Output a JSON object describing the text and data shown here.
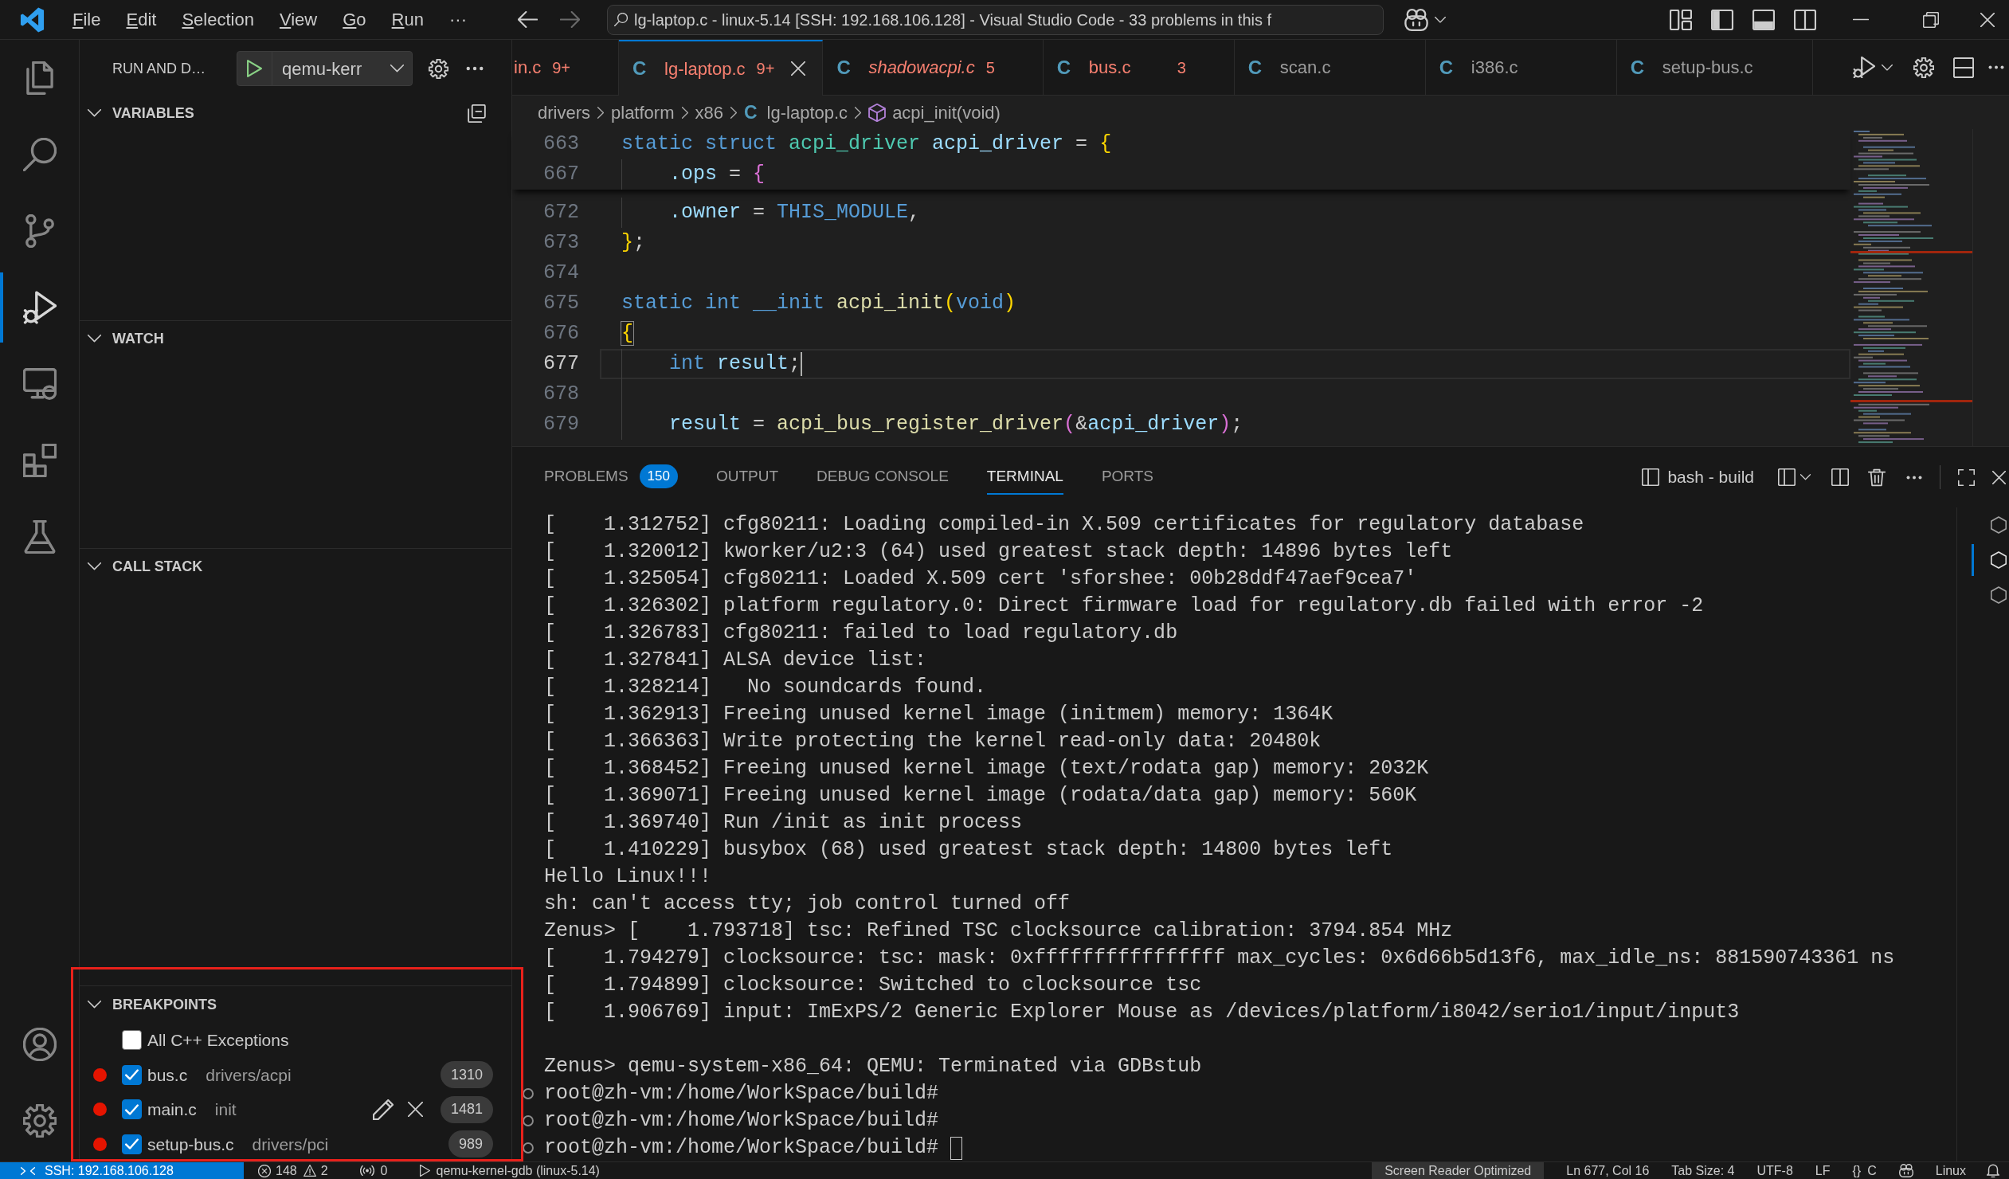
{
  "title_bar": {
    "menu": [
      {
        "label": "File",
        "mnemonic": true
      },
      {
        "label": "Edit",
        "mnemonic": true
      },
      {
        "label": "Selection",
        "mnemonic": true
      },
      {
        "label": "View",
        "mnemonic": true
      },
      {
        "label": "Go",
        "mnemonic": true
      },
      {
        "label": "Run",
        "mnemonic": true
      },
      {
        "label": "···",
        "mnemonic": false
      }
    ],
    "command_center": "lg-laptop.c - linux-5.14 [SSH: 192.168.106.128] - Visual Studio Code - 33 problems in this f"
  },
  "activity_bar": {
    "items": [
      {
        "kind": "explorer",
        "selected": false
      },
      {
        "kind": "search",
        "selected": false
      },
      {
        "kind": "source_control",
        "selected": false
      },
      {
        "kind": "run_debug",
        "selected": true
      },
      {
        "kind": "remote_explorer",
        "selected": false
      },
      {
        "kind": "extensions",
        "selected": false
      },
      {
        "kind": "testing",
        "selected": false
      }
    ],
    "bottom": [
      {
        "kind": "accounts"
      },
      {
        "kind": "manage"
      }
    ]
  },
  "sidebar": {
    "title": "RUN AND D…",
    "launch_config": "qemu-kerr",
    "sections": [
      {
        "kind": "variables",
        "title": "VARIABLES",
        "expanded": true
      },
      {
        "kind": "watch",
        "title": "WATCH",
        "expanded": true
      },
      {
        "kind": "call_stack",
        "title": "CALL STACK",
        "expanded": true
      },
      {
        "kind": "breakpoints",
        "title": "BREAKPOINTS",
        "expanded": true,
        "highlighted": true,
        "items": [
          {
            "kind": "exception",
            "label": "All C++ Exceptions",
            "checked": false,
            "hovered": false
          },
          {
            "kind": "source",
            "label": "bus.c",
            "path": "drivers/acpi",
            "line": "1310",
            "checked": true,
            "hovered": false
          },
          {
            "kind": "source",
            "label": "main.c",
            "path": "init",
            "line": "1481",
            "checked": true,
            "hovered": true
          },
          {
            "kind": "source",
            "label": "setup-bus.c",
            "path": "drivers/pci",
            "line": "989",
            "checked": true,
            "hovered": false
          }
        ]
      }
    ]
  },
  "editor": {
    "tabs": [
      {
        "label": "in.c",
        "badge": "9+",
        "selected": false,
        "preview": false,
        "error": true
      },
      {
        "icon": "C",
        "label": "lg-laptop.c",
        "badge": "9+",
        "selected": true,
        "preview": false,
        "error": true
      },
      {
        "icon": "C",
        "label": "shadowacpi.c",
        "badge": "5",
        "selected": false,
        "preview": true,
        "error": true
      },
      {
        "icon": "C",
        "label": "bus.c",
        "badge": "3",
        "selected": false,
        "preview": false,
        "error": true
      },
      {
        "icon": "C",
        "label": "scan.c",
        "selected": false,
        "preview": false,
        "error": false
      },
      {
        "icon": "C",
        "label": "i386.c",
        "selected": false,
        "preview": false,
        "error": false
      },
      {
        "icon": "C",
        "label": "setup-bus.c",
        "selected": false,
        "preview": false,
        "error": false
      }
    ],
    "breadcrumbs": [
      {
        "kind": "folder",
        "label": "drivers"
      },
      {
        "kind": "folder",
        "label": "platform"
      },
      {
        "kind": "folder",
        "label": "x86"
      },
      {
        "kind": "file",
        "icon": "C",
        "label": "lg-laptop.c"
      },
      {
        "kind": "symbol",
        "label": "acpi_init(void)"
      }
    ],
    "sticky_lines": [
      {
        "number": "663",
        "current": false,
        "tokens": [
          {
            "text": "static struct ",
            "kind": "keyword"
          },
          {
            "text": "acpi_driver ",
            "kind": "type"
          },
          {
            "text": "acpi_driver",
            "kind": "variable"
          },
          {
            "text": " = ",
            "kind": "plain"
          },
          {
            "text": "{",
            "kind": "bracket1"
          }
        ]
      },
      {
        "number": "667",
        "current": false,
        "tokens": [
          {
            "text": "    .ops",
            "kind": "variable"
          },
          {
            "text": " = ",
            "kind": "plain"
          },
          {
            "text": "{",
            "kind": "bracket2"
          }
        ]
      }
    ],
    "lines": [
      {
        "number": "672",
        "current": false,
        "tokens": [
          {
            "text": "    .owner",
            "kind": "variable"
          },
          {
            "text": " = ",
            "kind": "plain"
          },
          {
            "text": "THIS_MODULE",
            "kind": "macro"
          },
          {
            "text": ",",
            "kind": "plain"
          }
        ]
      },
      {
        "number": "673",
        "current": false,
        "tokens": [
          {
            "text": "}",
            "kind": "bracket1"
          },
          {
            "text": ";",
            "kind": "plain"
          }
        ]
      },
      {
        "number": "674",
        "current": false
      },
      {
        "number": "675",
        "current": false,
        "tokens": [
          {
            "text": "static int __init ",
            "kind": "keyword"
          },
          {
            "text": "acpi_init",
            "kind": "function"
          },
          {
            "text": "(",
            "kind": "bracket1"
          },
          {
            "text": "void",
            "kind": "keyword"
          },
          {
            "text": ")",
            "kind": "bracket1"
          }
        ]
      },
      {
        "number": "676",
        "current": false,
        "tokens": [
          {
            "text": "{",
            "kind": "bracket_match"
          }
        ]
      },
      {
        "number": "677",
        "current": true,
        "tokens": [
          {
            "text": "    int ",
            "kind": "keyword"
          },
          {
            "text": "result",
            "kind": "variable"
          },
          {
            "text": ";",
            "kind": "plain"
          }
        ]
      },
      {
        "number": "678",
        "current": false
      },
      {
        "number": "679",
        "current": false,
        "tokens": [
          {
            "text": "    result",
            "kind": "variable"
          },
          {
            "text": " = ",
            "kind": "plain"
          },
          {
            "text": "acpi_bus_register_driver",
            "kind": "function"
          },
          {
            "text": "(",
            "kind": "bracket2"
          },
          {
            "text": "&",
            "kind": "plain"
          },
          {
            "text": "acpi_driver",
            "kind": "variable"
          },
          {
            "text": ")",
            "kind": "bracket2"
          },
          {
            "text": ";",
            "kind": "plain"
          }
        ]
      }
    ]
  },
  "panel": {
    "tabs": [
      {
        "label": "PROBLEMS",
        "badge": "150",
        "selected": false
      },
      {
        "label": "OUTPUT",
        "selected": false
      },
      {
        "label": "DEBUG CONSOLE",
        "selected": false
      },
      {
        "label": "TERMINAL",
        "selected": true
      },
      {
        "label": "PORTS",
        "selected": false
      }
    ],
    "terminal_name": "bash - build",
    "terminal_lines": [
      {
        "kind": "output",
        "text": "[    1.312752] cfg80211: Loading compiled-in X.509 certificates for regulatory database"
      },
      {
        "kind": "output",
        "text": "[    1.320012] kworker/u2:3 (64) used greatest stack depth: 14896 bytes left"
      },
      {
        "kind": "output",
        "text": "[    1.325054] cfg80211: Loaded X.509 cert 'sforshee: 00b28ddf47aef9cea7'"
      },
      {
        "kind": "output",
        "text": "[    1.326302] platform regulatory.0: Direct firmware load for regulatory.db failed with error -2"
      },
      {
        "kind": "output",
        "text": "[    1.326783] cfg80211: failed to load regulatory.db"
      },
      {
        "kind": "output",
        "text": "[    1.327841] ALSA device list:"
      },
      {
        "kind": "output",
        "text": "[    1.328214]   No soundcards found."
      },
      {
        "kind": "output",
        "text": "[    1.362913] Freeing unused kernel image (initmem) memory: 1364K"
      },
      {
        "kind": "output",
        "text": "[    1.366363] Write protecting the kernel read-only data: 20480k"
      },
      {
        "kind": "output",
        "text": "[    1.368452] Freeing unused kernel image (text/rodata gap) memory: 2032K"
      },
      {
        "kind": "output",
        "text": "[    1.369071] Freeing unused kernel image (rodata/data gap) memory: 560K"
      },
      {
        "kind": "output",
        "text": "[    1.369740] Run /init as init process"
      },
      {
        "kind": "output",
        "text": "[    1.410229] busybox (68) used greatest stack depth: 14800 bytes left"
      },
      {
        "kind": "output",
        "text": "Hello Linux!!!"
      },
      {
        "kind": "output",
        "text": "sh: can't access tty; job control turned off"
      },
      {
        "kind": "output",
        "text": "Zenus> [    1.793718] tsc: Refined TSC clocksource calibration: 3794.854 MHz"
      },
      {
        "kind": "output",
        "text": "[    1.794279] clocksource: tsc: mask: 0xffffffffffffffff max_cycles: 0x6d66b5d13f6, max_idle_ns: 881590743361 ns"
      },
      {
        "kind": "output",
        "text": "[    1.794899] clocksource: Switched to clocksource tsc"
      },
      {
        "kind": "output",
        "text": "[    1.906769] input: ImExPS/2 Generic Explorer Mouse as /devices/platform/i8042/serio1/input/input3"
      },
      {
        "kind": "blank"
      },
      {
        "kind": "output",
        "text": "Zenus> qemu-system-x86_64: QEMU: Terminated via GDBstub"
      },
      {
        "kind": "command",
        "text": "root@zh-vm:/home/WorkSpace/build#"
      },
      {
        "kind": "command",
        "text": "root@zh-vm:/home/WorkSpace/build#"
      },
      {
        "kind": "input",
        "text": "root@zh-vm:/home/WorkSpace/build#"
      }
    ],
    "terminal_tabs": [
      {
        "selected": false
      },
      {
        "selected": true
      },
      {
        "selected": false
      }
    ]
  },
  "status_bar": {
    "left": [
      {
        "kind": "remote",
        "label": "SSH: 192.168.106.128"
      },
      {
        "kind": "problems",
        "errors": "148",
        "warnings": "2"
      },
      {
        "kind": "ports",
        "label": "0"
      },
      {
        "kind": "debug",
        "label": "qemu-kernel-gdb (linux-5.14)"
      }
    ],
    "right": [
      {
        "kind": "accessibility",
        "label": "Screen Reader Optimized"
      },
      {
        "kind": "text",
        "label": "Ln 677, Col 16"
      },
      {
        "kind": "text",
        "label": "Tab Size: 4"
      },
      {
        "kind": "text",
        "label": "UTF-8"
      },
      {
        "kind": "text",
        "label": "LF"
      },
      {
        "kind": "language",
        "icon": "{}",
        "label": "C"
      },
      {
        "kind": "assistant"
      },
      {
        "kind": "text",
        "label": "Linux"
      },
      {
        "kind": "notifications"
      }
    ]
  }
}
